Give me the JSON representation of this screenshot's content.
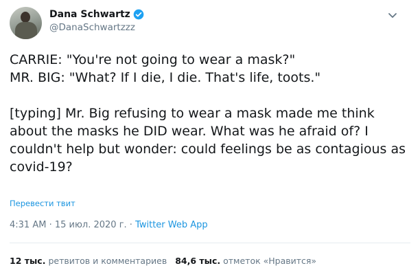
{
  "author": {
    "display_name": "Dana Schwartz",
    "handle": "@DanaSchwartzzz",
    "verified_icon": "verified-badge-icon",
    "accent_color": "#1da1f2"
  },
  "tweet": {
    "text": "CARRIE: \"You're not going to wear a mask?\"\nMR. BIG: \"What? If I die, I die. That's life, toots.\"\n\n[typing] Mr. Big refusing to wear a mask made me think about the masks he DID wear. What was he afraid of? I couldn't help but wonder: could feelings be as contagious as covid-19?",
    "translate_label": "Перевести твит",
    "time": "4:31 AM",
    "date": "15 июл. 2020 г.",
    "separator": " · ",
    "source": "Twitter Web App"
  },
  "stats": {
    "retweets_count": "12 тыс.",
    "retweets_label": "ретвитов и комментариев",
    "likes_count": "84,6 тыс.",
    "likes_label": "отметок «Нравится»"
  },
  "icons": {
    "more": "chevron-down-icon"
  }
}
